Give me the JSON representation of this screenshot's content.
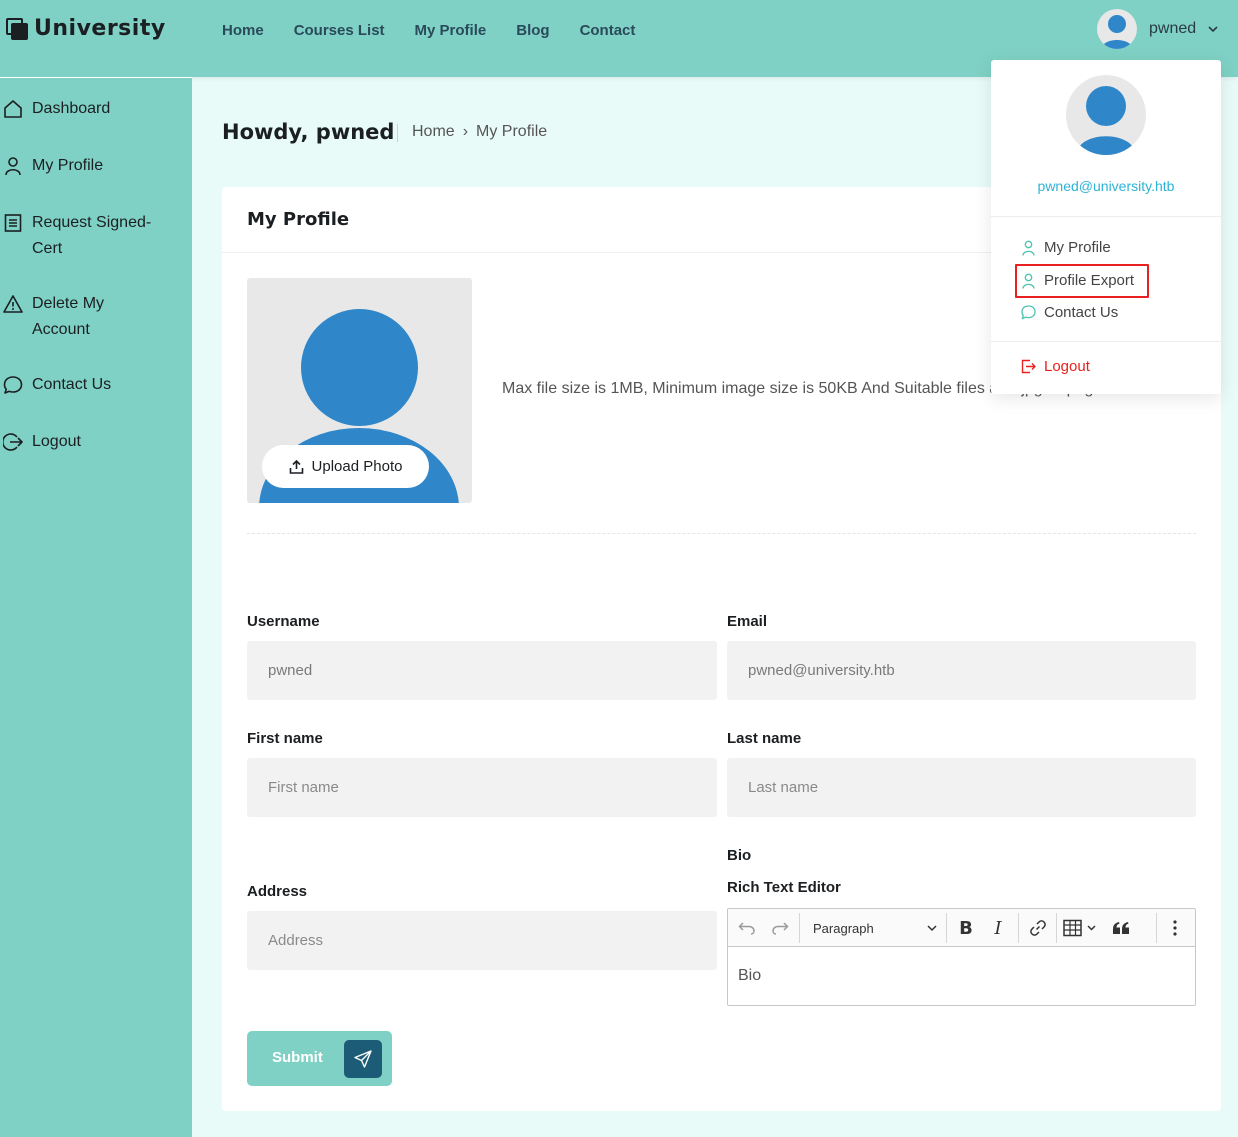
{
  "brand": {
    "name": "University"
  },
  "nav": {
    "items": [
      {
        "label": "Home"
      },
      {
        "label": "Courses List"
      },
      {
        "label": "My Profile"
      },
      {
        "label": "Blog"
      },
      {
        "label": "Contact"
      }
    ]
  },
  "user": {
    "name": "pwned",
    "email": "pwned@university.htb"
  },
  "sidebar": {
    "items": [
      {
        "label": "Dashboard",
        "icon": "home-icon"
      },
      {
        "label": "My Profile",
        "icon": "user-icon"
      },
      {
        "label": "Request Signed-Cert",
        "icon": "document-icon"
      },
      {
        "label": "Delete My Account",
        "icon": "warning-icon"
      },
      {
        "label": "Contact Us",
        "icon": "chat-icon"
      },
      {
        "label": "Logout",
        "icon": "logout-icon"
      }
    ]
  },
  "page": {
    "greeting": "Howdy, pwned",
    "breadcrumb": {
      "home": "Home",
      "separator": "›",
      "current": "My Profile"
    }
  },
  "card": {
    "title": "My Profile",
    "upload_label": "Upload Photo",
    "file_note": "Max file size is 1MB, Minimum image size is 50KB And Suitable files are .jpg & .png"
  },
  "form": {
    "username": {
      "label": "Username",
      "value": "pwned"
    },
    "email": {
      "label": "Email",
      "value": "pwned@university.htb"
    },
    "first_name": {
      "label": "First name",
      "placeholder": "First name"
    },
    "last_name": {
      "label": "Last name",
      "placeholder": "Last name"
    },
    "address": {
      "label": "Address",
      "placeholder": "Address"
    },
    "bio": {
      "label": "Bio",
      "editor_label": "Rich Text Editor",
      "block_format": "Paragraph",
      "placeholder": "Bio"
    },
    "submit_label": "Submit"
  },
  "dropdown": {
    "email": "pwned@university.htb",
    "items": [
      {
        "label": "My Profile",
        "icon": "user-icon"
      },
      {
        "label": "Profile Export",
        "icon": "user-icon"
      },
      {
        "label": "Contact Us",
        "icon": "chat-icon"
      }
    ],
    "logout_label": "Logout"
  },
  "colors": {
    "teal": "#7fd1c5",
    "page_bg": "#e9fbf9",
    "avatar_blue": "#2f86c8",
    "link_blue": "#2eb3d6",
    "logout_red": "#e8201f",
    "highlight_red": "#e8201f",
    "send_button": "#1c5c77"
  }
}
